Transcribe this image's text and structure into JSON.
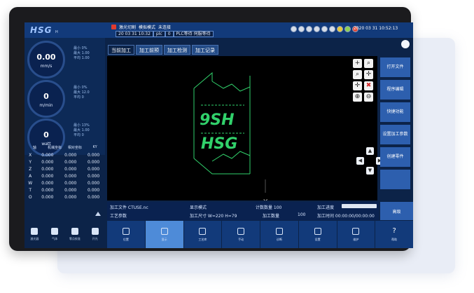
{
  "app": {
    "logo": "HSG",
    "logo_sub": "H",
    "title": "激光切割"
  },
  "status": {
    "line1": "模拟模式",
    "line1b": "未连接",
    "date_small": "20 03 31 10:32",
    "plc": "plc",
    "zero": "0",
    "plc_state": "PLC等待 伺服等待"
  },
  "datetime": "2020 03 31 10:52:13",
  "gauges": [
    {
      "value": "0.00",
      "unit": "mm/s",
      "stats": [
        "最小  0%",
        "最大  1.00",
        "平均  1.00"
      ]
    },
    {
      "value": "0",
      "unit": "m/min",
      "stats": [
        "最小  0%",
        "最大  12.0",
        "平均  0"
      ]
    },
    {
      "value": "0",
      "unit": "watt",
      "stats": [
        "最小  13%",
        "最大  1.00",
        "平均  0"
      ]
    }
  ],
  "coords": {
    "headers": [
      "轴",
      "机械坐标",
      "相对坐标",
      "KY"
    ],
    "rows": [
      [
        "X",
        "0.000",
        "0.000",
        "0.000"
      ],
      [
        "Y",
        "0.000",
        "0.000",
        "0.000"
      ],
      [
        "Z",
        "0.000",
        "0.000",
        "0.000"
      ],
      [
        "A",
        "0.000",
        "0.000",
        "0.000"
      ],
      [
        "W",
        "0.000",
        "0.000",
        "0.000"
      ],
      [
        "T",
        "0.000",
        "0.000",
        "0.000"
      ],
      [
        "O",
        "0.000",
        "0.000",
        "0.000"
      ]
    ]
  },
  "left_bottom": [
    "激光器",
    "气体",
    "零点校准",
    "开光"
  ],
  "tabs": [
    "当前加工",
    "加工前预",
    "加工检测",
    "加工记录"
  ],
  "canvas_text": [
    "9SH",
    "HSG"
  ],
  "tools": [
    "+",
    "⌕",
    "⌕",
    "✛",
    "✛",
    "✖",
    "⊕",
    "⊖"
  ],
  "right_buttons": [
    "打开文件",
    "程序编辑",
    "快捷功能",
    "设置加工参数",
    "创建零件",
    "",
    ""
  ],
  "info": {
    "file": "加工文件 CTUSE.nc",
    "display": "显示模式",
    "count": "计数数量 100",
    "progress_label": "加工进度",
    "progress_value": "0",
    "params": "工艺参数",
    "size": "加工尺寸 W=220 H=79",
    "target": "加工数量",
    "target_val": "100",
    "time": "加工时间 00:00:00/00:00:00"
  },
  "bottom_right": "高级",
  "bottom_bar": [
    "位置",
    "显示",
    "工艺库",
    "手动",
    "诊断",
    "设置",
    "维护",
    "帮助"
  ],
  "colors": {
    "accent": "#2d5fae",
    "active": "#4e8bd8",
    "graphic": "#31d16b"
  }
}
